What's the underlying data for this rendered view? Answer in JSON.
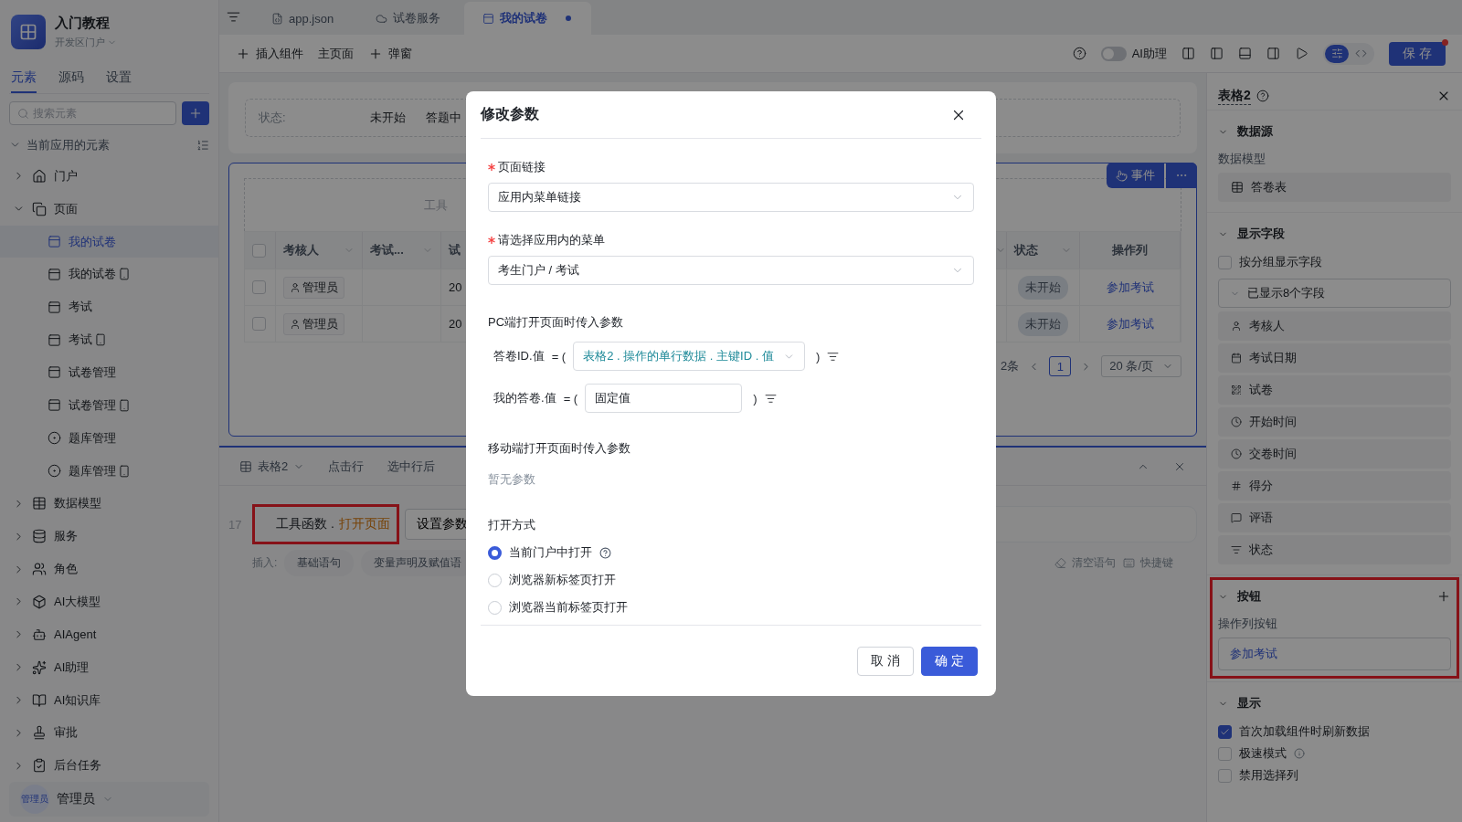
{
  "sidebar": {
    "app_title": "入门教程",
    "app_subtitle": "开发区门户",
    "tabs": [
      {
        "label": "元素",
        "selected": true
      },
      {
        "label": "源码",
        "selected": false
      },
      {
        "label": "设置",
        "selected": false
      }
    ],
    "search": {
      "placeholder": "搜索元素"
    },
    "tree_title": "当前应用的元素",
    "tree": [
      {
        "label": "门户",
        "expanded": false
      },
      {
        "label": "页面",
        "expanded": true,
        "children": [
          {
            "label": "我的试卷",
            "selected": true,
            "mobile": false
          },
          {
            "label": "我的试卷",
            "selected": false,
            "mobile": true
          },
          {
            "label": "考试",
            "selected": false,
            "mobile": false
          },
          {
            "label": "考试",
            "selected": false,
            "mobile": true
          },
          {
            "label": "试卷管理",
            "selected": false,
            "mobile": false
          },
          {
            "label": "试卷管理",
            "selected": false,
            "mobile": true
          },
          {
            "label": "题库管理",
            "selected": false,
            "mobile": false
          },
          {
            "label": "题库管理",
            "selected": false,
            "mobile": true
          }
        ]
      },
      {
        "label": "数据模型",
        "expanded": false
      },
      {
        "label": "服务",
        "expanded": false
      },
      {
        "label": "角色",
        "expanded": false
      },
      {
        "label": "AI大模型",
        "expanded": false
      },
      {
        "label": "AIAgent",
        "expanded": false
      },
      {
        "label": "AI助理",
        "expanded": false
      },
      {
        "label": "AI知识库",
        "expanded": false
      },
      {
        "label": "审批",
        "expanded": false
      },
      {
        "label": "后台任务",
        "expanded": false
      }
    ],
    "user": "管理员",
    "avatar_label": "管理员"
  },
  "file_tabs": [
    {
      "label": "app.json",
      "selected": false,
      "modified": false
    },
    {
      "label": "试卷服务",
      "selected": false,
      "modified": false
    },
    {
      "label": "我的试卷",
      "selected": true,
      "modified": true
    }
  ],
  "toolbar": {
    "items": [
      {
        "label": "插入组件",
        "kind": "add"
      },
      {
        "label": "主页面",
        "kind": "plain"
      },
      {
        "label": "弹窗",
        "kind": "add"
      }
    ],
    "ai_toggle": {
      "label": "AI助理",
      "on": false
    },
    "view_modes": [
      {
        "kind": "design",
        "selected": true
      },
      {
        "kind": "code",
        "selected": false
      }
    ],
    "save": "保 存",
    "save_notice": true
  },
  "canvas": {
    "filter": {
      "label": "状态:",
      "options": [
        "未开始",
        "答题中"
      ]
    },
    "table": {
      "toolbar_placeholder": "工具",
      "event_button": "事件",
      "header_checked": false,
      "columns": [
        {
          "label": "考核人",
          "sortable": true
        },
        {
          "label": "考试...",
          "sortable": true
        },
        {
          "label": "试"
        }
      ],
      "right_columns": [
        {
          "sortable": true
        },
        {
          "label": "状态",
          "sortable": true
        },
        {
          "label": "操作列"
        }
      ],
      "rows": [
        {
          "checked": false,
          "reviewer": "管理员",
          "column_3": "20",
          "status": "未开始",
          "action": "参加考试"
        },
        {
          "checked": false,
          "reviewer": "管理员",
          "column_3": "20",
          "status": "未开始",
          "action": "参加考试"
        }
      ],
      "pagination": {
        "total": "2条",
        "page": "1",
        "page_size": "20 条/页"
      }
    }
  },
  "editor": {
    "component": "表格2",
    "events": [
      "点击行",
      "选中行后"
    ],
    "line_number": "17",
    "code_parts": [
      {
        "text": "工具函数 .",
        "kind": "object"
      },
      {
        "text": "打开页面",
        "kind": "method"
      }
    ],
    "highlighted": true,
    "action_button": "设置参数",
    "insert_label": "插入:",
    "snippets": [
      "基础语句",
      "变量声明及赋值语"
    ],
    "tools": [
      "清空语句",
      "快捷键"
    ]
  },
  "modal": {
    "title": "修改参数",
    "fields": [
      {
        "label": "页面链接",
        "required": true,
        "value": "应用内菜单链接"
      },
      {
        "label": "请选择应用内的菜单",
        "required": true,
        "value": "考生门户 / 考试"
      }
    ],
    "pc_params_title": "PC端打开页面时传入参数",
    "params": [
      {
        "name": "答卷ID.值",
        "open": "= (",
        "kind": "select",
        "value": "表格2 . 操作的单行数据 . 主键ID . 值",
        "close": ")"
      },
      {
        "name": "我的答卷.值",
        "open": "= (",
        "kind": "input",
        "value": "固定值",
        "close": ")"
      }
    ],
    "mobile_params_title": "移动端打开页面时传入参数",
    "mobile_params_empty": "暂无参数",
    "open_mode_title": "打开方式",
    "open_modes": [
      {
        "label": "当前门户中打开",
        "selected": true,
        "help": true
      },
      {
        "label": "浏览器新标签页打开",
        "selected": false,
        "help": false
      },
      {
        "label": "浏览器当前标签页打开",
        "selected": false,
        "help": false
      }
    ],
    "cancel": "取 消",
    "confirm": "确 定"
  },
  "inspector": {
    "title": "表格2",
    "sections": [
      {
        "title": "数据源",
        "kind": "datasource",
        "label": "数据模型",
        "value": "答卷表"
      },
      {
        "title": "显示字段",
        "kind": "fields",
        "group_by": {
          "label": "按分组显示字段",
          "checked": false
        },
        "summary": "已显示8个字段",
        "fields": [
          "考核人",
          "考试日期",
          "试卷",
          "开始时间",
          "交卷时间",
          "得分",
          "评语",
          "状态"
        ]
      },
      {
        "title": "按钮",
        "kind": "buttons",
        "highlighted": true,
        "label": "操作列按钮",
        "buttons": [
          "参加考试"
        ]
      },
      {
        "title": "显示",
        "kind": "options",
        "options": [
          {
            "label": "首次加载组件时刷新数据",
            "checked": true,
            "info": false
          },
          {
            "label": "极速模式",
            "checked": false,
            "info": true
          },
          {
            "label": "禁用选择列",
            "checked": false,
            "info": false
          }
        ]
      }
    ]
  }
}
